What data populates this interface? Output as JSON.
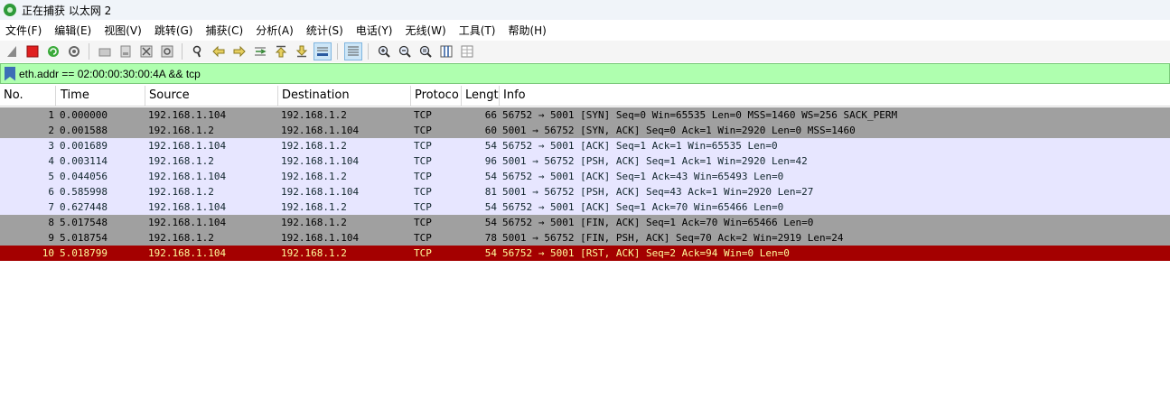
{
  "window": {
    "title": "正在捕获 以太网 2"
  },
  "menu": [
    {
      "label": "文件(F)"
    },
    {
      "label": "编辑(E)"
    },
    {
      "label": "视图(V)"
    },
    {
      "label": "跳转(G)"
    },
    {
      "label": "捕获(C)"
    },
    {
      "label": "分析(A)"
    },
    {
      "label": "统计(S)"
    },
    {
      "label": "电话(Y)"
    },
    {
      "label": "无线(W)"
    },
    {
      "label": "工具(T)"
    },
    {
      "label": "帮助(H)"
    }
  ],
  "toolbar": {
    "icons": [
      "shark-fin-icon",
      "stop-icon",
      "restart-icon",
      "options-gear-icon",
      "open-file-icon",
      "save-file-icon",
      "close-file-icon",
      "reload-icon",
      "find-icon",
      "go-back-icon",
      "go-forward-icon",
      "go-to-packet-icon",
      "go-first-icon",
      "go-last-icon",
      "autoscroll-icon",
      "colorize-icon",
      "zoom-in-icon",
      "zoom-out-icon",
      "zoom-normal-icon",
      "resize-columns-icon",
      "layout-icon"
    ],
    "accent": "#2e9a3a"
  },
  "filter": {
    "value": "eth.addr == 02:00:00:30:00:4A && tcp",
    "background": "#afffaf"
  },
  "columns": [
    "No.",
    "Time",
    "Source",
    "Destination",
    "Protoco",
    "Lengt",
    "Info"
  ],
  "colors": {
    "gray": "#a0a0a0",
    "lavender": "#e7e6ff",
    "rst_bg": "#a40000",
    "rst_fg": "#fffc9c"
  },
  "packets": [
    {
      "no": "1",
      "time": "0.000000",
      "src": "192.168.1.104",
      "dst": "192.168.1.2",
      "proto": "TCP",
      "len": "66",
      "info": "56752 → 5001 [SYN] Seq=0 Win=65535 Len=0 MSS=1460 WS=256 SACK_PERM",
      "style": "gray"
    },
    {
      "no": "2",
      "time": "0.001588",
      "src": "192.168.1.2",
      "dst": "192.168.1.104",
      "proto": "TCP",
      "len": "60",
      "info": "5001 → 56752 [SYN, ACK] Seq=0 Ack=1 Win=2920 Len=0 MSS=1460",
      "style": "gray"
    },
    {
      "no": "3",
      "time": "0.001689",
      "src": "192.168.1.104",
      "dst": "192.168.1.2",
      "proto": "TCP",
      "len": "54",
      "info": "56752 → 5001 [ACK] Seq=1 Ack=1 Win=65535 Len=0",
      "style": "lavender"
    },
    {
      "no": "4",
      "time": "0.003114",
      "src": "192.168.1.2",
      "dst": "192.168.1.104",
      "proto": "TCP",
      "len": "96",
      "info": "5001 → 56752 [PSH, ACK] Seq=1 Ack=1 Win=2920 Len=42",
      "style": "lavender"
    },
    {
      "no": "5",
      "time": "0.044056",
      "src": "192.168.1.104",
      "dst": "192.168.1.2",
      "proto": "TCP",
      "len": "54",
      "info": "56752 → 5001 [ACK] Seq=1 Ack=43 Win=65493 Len=0",
      "style": "lavender"
    },
    {
      "no": "6",
      "time": "0.585998",
      "src": "192.168.1.2",
      "dst": "192.168.1.104",
      "proto": "TCP",
      "len": "81",
      "info": "5001 → 56752 [PSH, ACK] Seq=43 Ack=1 Win=2920 Len=27",
      "style": "lavender"
    },
    {
      "no": "7",
      "time": "0.627448",
      "src": "192.168.1.104",
      "dst": "192.168.1.2",
      "proto": "TCP",
      "len": "54",
      "info": "56752 → 5001 [ACK] Seq=1 Ack=70 Win=65466 Len=0",
      "style": "lavender"
    },
    {
      "no": "8",
      "time": "5.017548",
      "src": "192.168.1.104",
      "dst": "192.168.1.2",
      "proto": "TCP",
      "len": "54",
      "info": "56752 → 5001 [FIN, ACK] Seq=1 Ack=70 Win=65466 Len=0",
      "style": "gray"
    },
    {
      "no": "9",
      "time": "5.018754",
      "src": "192.168.1.2",
      "dst": "192.168.1.104",
      "proto": "TCP",
      "len": "78",
      "info": "5001 → 56752 [FIN, PSH, ACK] Seq=70 Ack=2 Win=2919 Len=24",
      "style": "gray"
    },
    {
      "no": "10",
      "time": "5.018799",
      "src": "192.168.1.104",
      "dst": "192.168.1.2",
      "proto": "TCP",
      "len": "54",
      "info": "56752 → 5001 [RST, ACK] Seq=2 Ack=94 Win=0 Len=0",
      "style": "rst"
    }
  ]
}
